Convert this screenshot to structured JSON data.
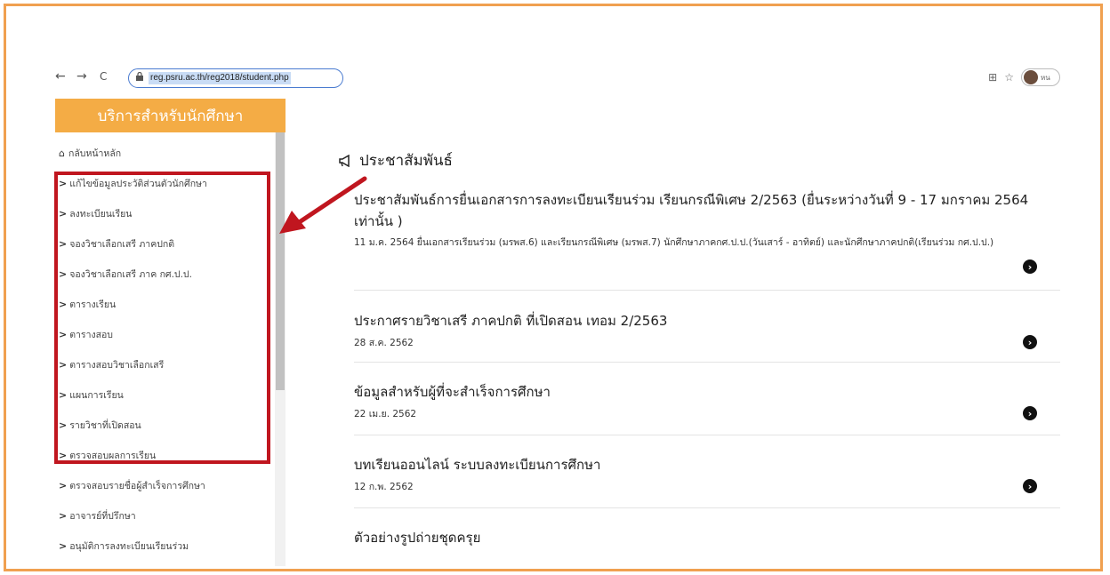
{
  "browser": {
    "url": "reg.psru.ac.th/reg2018/student.php",
    "back_icon": "←",
    "forward_icon": "→",
    "reload_icon": "C",
    "qr_icon": "⊞",
    "star_icon": "☆",
    "profile_text": "หน"
  },
  "sidebar": {
    "header": "บริการสำหรับนักศึกษา",
    "home_label": "กลับหน้าหลัก",
    "items": [
      {
        "label": "แก้ไขข้อมูลประวัติส่วนตัวนักศึกษา"
      },
      {
        "label": "ลงทะเบียนเรียน"
      },
      {
        "label": "จองวิชาเลือกเสรี ภาคปกติ"
      },
      {
        "label": "จองวิชาเลือกเสรี ภาค กศ.ป.ป."
      },
      {
        "label": "ตารางเรียน"
      },
      {
        "label": "ตารางสอบ"
      },
      {
        "label": "ตารางสอบวิชาเลือกเสรี"
      },
      {
        "label": "แผนการเรียน"
      },
      {
        "label": "รายวิชาที่เปิดสอน"
      },
      {
        "label": "ตรวจสอบผลการเรียน"
      },
      {
        "label": "ตรวจสอบรายชื่อผู้สำเร็จการศึกษา"
      },
      {
        "label": "อาจารย์ที่ปรึกษา"
      },
      {
        "label": "อนุมัติการลงทะเบียนเรียนร่วม"
      }
    ]
  },
  "main": {
    "section_title": "ประชาสัมพันธ์",
    "news": [
      {
        "title": "ประชาสัมพันธ์การยื่นเอกสารการลงทะเบียนเรียนร่วม เรียนกรณีพิเศษ 2/2563 (ยื่นระหว่างวันที่ 9 - 17 มกราคม 2564 เท่านั้น )",
        "date": "11 ม.ค. 2564",
        "desc": "ยื่นเอกสารเรียนร่วม (มรพส.6) และเรียนกรณีพิเศษ (มรพส.7) นักศึกษาภาคกศ.ป.ป.(วันเสาร์ - อาทิตย์) และนักศึกษาภาคปกติ(เรียนร่วม กศ.ป.ป.)"
      },
      {
        "title": "ประกาศรายวิชาเสรี ภาคปกติ ที่เปิดสอน เทอม 2/2563",
        "date": "28 ส.ค. 2562"
      },
      {
        "title": "ข้อมูลสำหรับผู้ที่จะสำเร็จการศึกษา",
        "date": "22 เม.ย. 2562"
      },
      {
        "title": "บทเรียนออนไลน์ ระบบลงทะเบียนการศึกษา",
        "date": "12 ก.พ. 2562"
      },
      {
        "title": "ตัวอย่างรูปถ่ายชุดครุย"
      }
    ]
  },
  "colors": {
    "accent": "#f4ac45",
    "highlight": "#c0161f",
    "frame": "#f0a050"
  }
}
